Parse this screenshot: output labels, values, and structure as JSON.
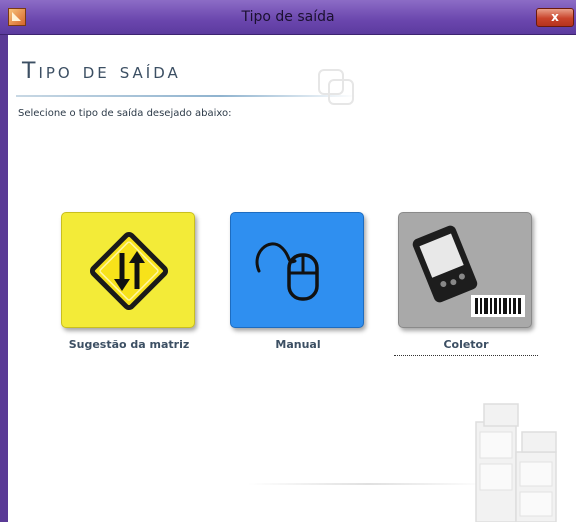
{
  "window": {
    "title": "Tipo de saída",
    "close_symbol": "x"
  },
  "main": {
    "heading": "Tipo de saída",
    "subtitle": "Selecione o tipo de saída desejado abaixo:"
  },
  "options": [
    {
      "label": "Sugestão da matriz",
      "icon": "road-sign-arrows-icon",
      "color": "#f3eb38"
    },
    {
      "label": "Manual",
      "icon": "mouse-icon",
      "color": "#2f8ff0"
    },
    {
      "label": "Coletor",
      "icon": "handheld-barcode-scanner-icon",
      "color": "#a9a9a9"
    }
  ]
}
